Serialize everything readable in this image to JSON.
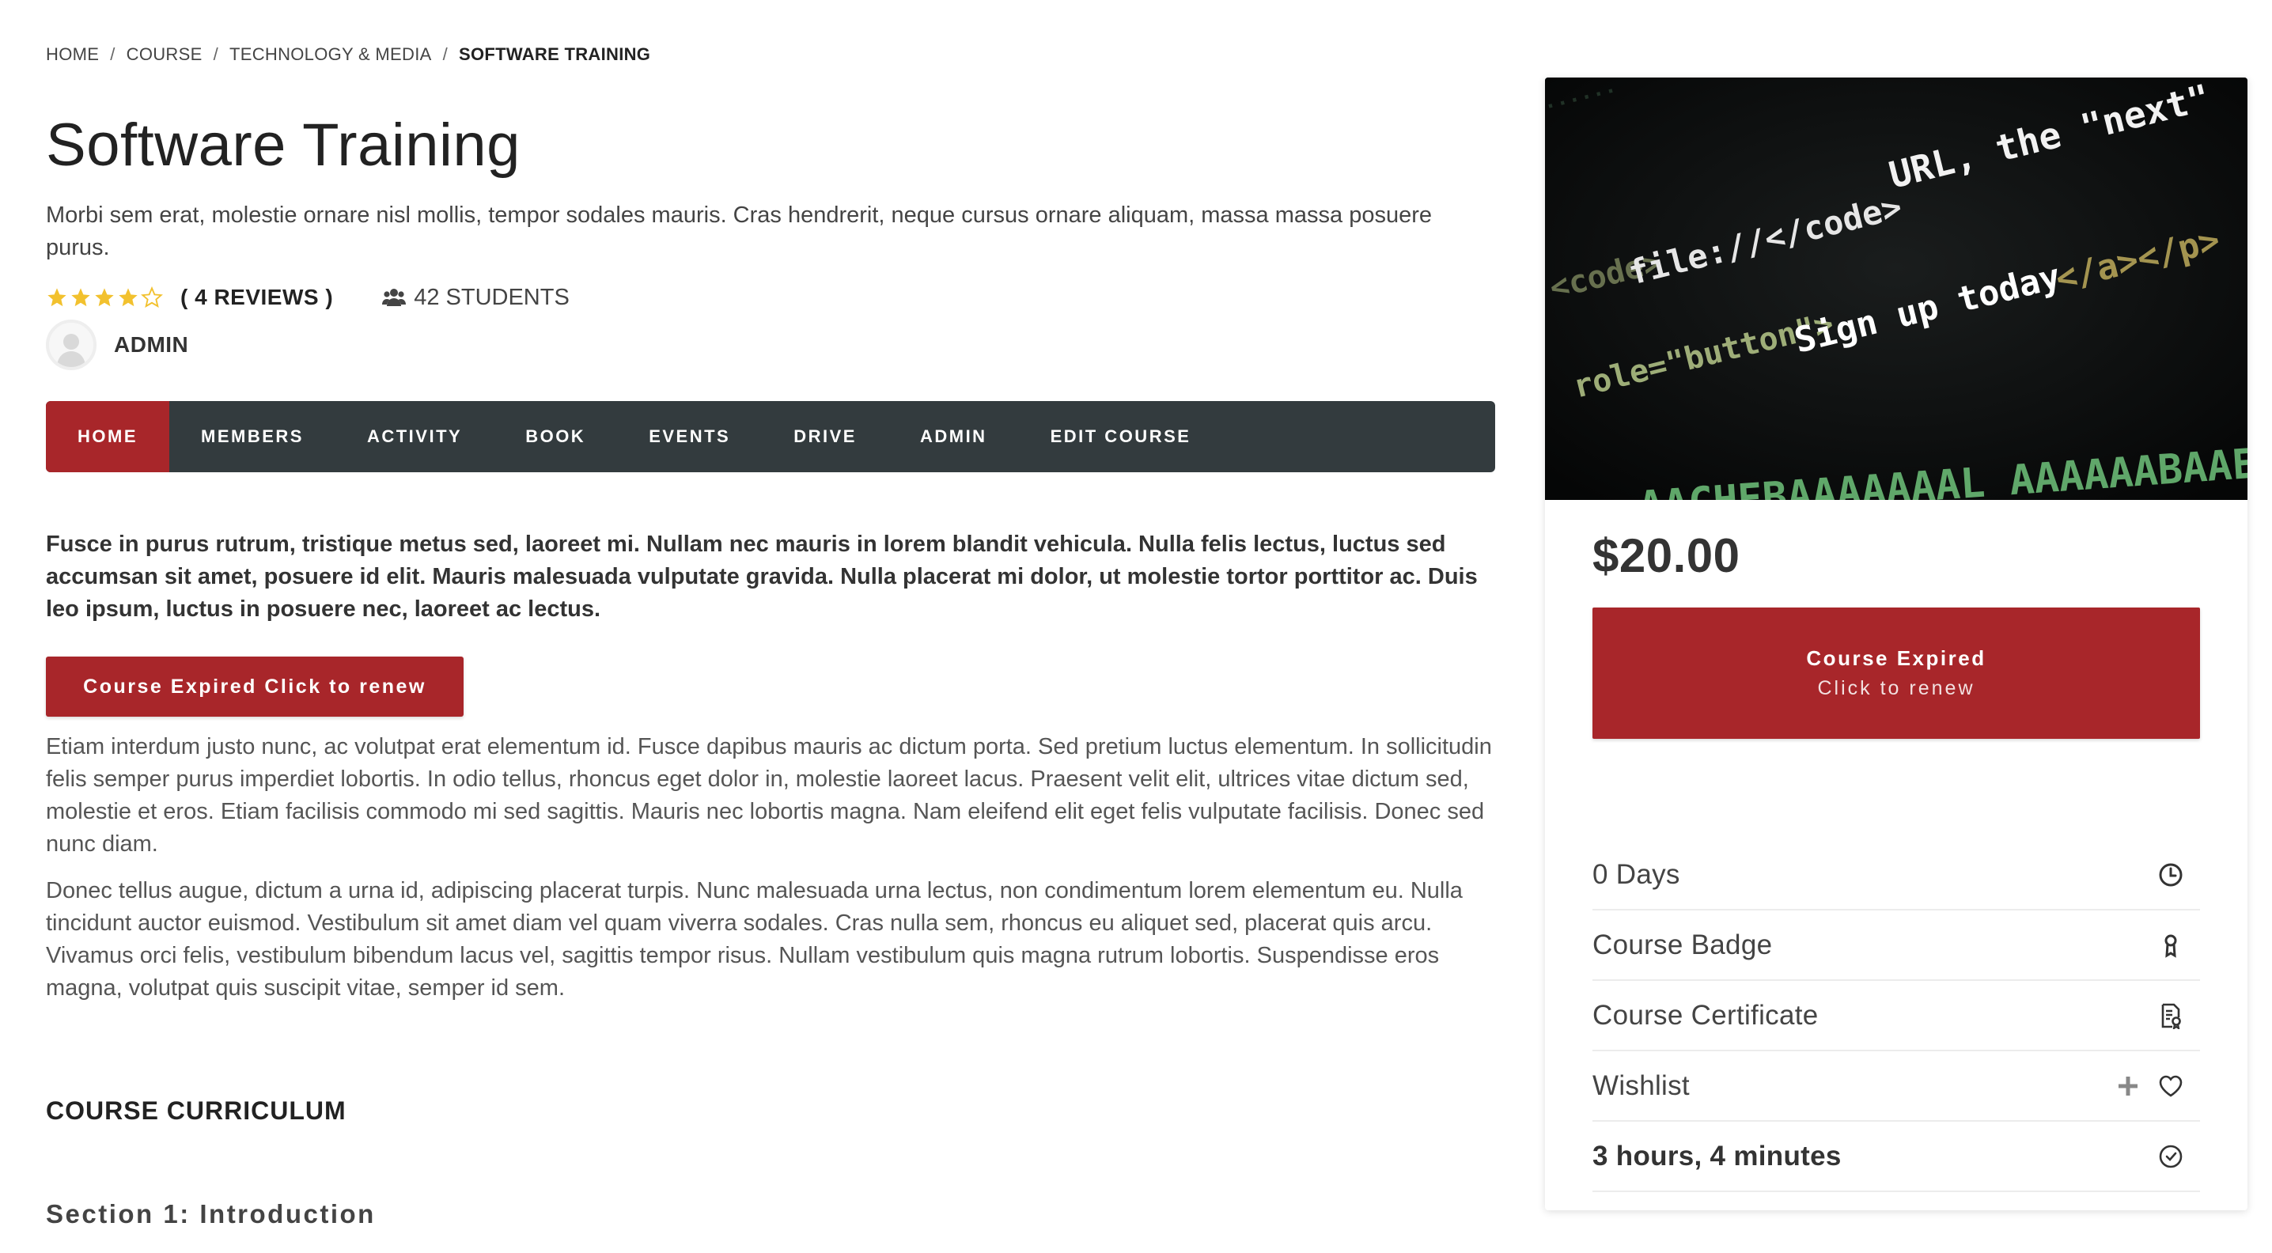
{
  "breadcrumb": {
    "home": "HOME",
    "course": "COURSE",
    "category": "TECHNOLOGY & MEDIA",
    "current": "SOFTWARE TRAINING",
    "separator": "/"
  },
  "course": {
    "title": "Software Training",
    "subtitle": "Morbi sem erat, molestie ornare nisl mollis, tempor sodales mauris. Cras hendrerit, neque cursus ornare aliquam, massa massa posuere purus.",
    "rating": 4,
    "rating_max": 5,
    "reviews_label": "( 4 REVIEWS )",
    "students_label": "42 STUDENTS",
    "instructor": "ADMIN"
  },
  "nav": {
    "tabs": [
      "HOME",
      "MEMBERS",
      "ACTIVITY",
      "BOOK",
      "EVENTS",
      "DRIVE",
      "ADMIN",
      "EDIT COURSE"
    ],
    "active": "HOME"
  },
  "content": {
    "lead": "Fusce in purus rutrum, tristique metus sed, laoreet mi. Nullam nec mauris in lorem blandit vehicula. Nulla felis lectus, luctus sed accumsan sit amet, posuere id elit. Mauris malesuada vulputate gravida. Nulla placerat mi dolor, ut molestie tortor porttitor ac. Duis leo ipsum, luctus in posuere nec, laoreet ac lectus.",
    "renew_button": "Course Expired Click to renew",
    "paragraph1": "Etiam interdum justo nunc, ac volutpat erat elementum id. Fusce dapibus mauris ac dictum porta. Sed pretium luctus elementum. In sollicitudin felis semper purus imperdiet lobortis. In odio tellus, rhoncus eget dolor in, molestie laoreet lacus. Praesent velit elit, ultrices vitae dictum sed, molestie et eros. Etiam facilisis commodo mi sed sagittis. Mauris nec lobortis magna. Nam eleifend elit eget felis vulputate facilisis. Donec sed nunc diam.",
    "paragraph2": "Donec tellus augue, dictum a urna id, adipiscing placerat turpis. Nunc malesuada urna lectus, non condimentum lorem elementum eu. Nulla tincidunt auctor euismod. Vestibulum sit amet diam vel quam viverra sodales. Cras nulla sem, rhoncus eu aliquet sed, placerat quis arcu. Vivamus orci felis, vestibulum bibendum lacus vel, sagittis tempor risus. Nullam vestibulum quis magna rutrum lobortis. Suspendisse eros magna, volutpat quis suscipit vitae, semper id sem.",
    "curriculum_heading": "COURSE CURRICULUM",
    "section_heading": "Section 1: Introduction"
  },
  "sidebar": {
    "hero_code": {
      "line1": "URL, the \"next\"",
      "line2_tag1": "<code>",
      "line2_text": "file://</code>",
      "line3_attr": "role=\"button\">",
      "line3_text": "Sign up today",
      "line3_end": "</a></p>",
      "line4": "AACHEBAAAAAAAL AAAAAABAAEAAAICP"
    },
    "price": "$20.00",
    "button_line1": "Course Expired",
    "button_line2": "Click to renew",
    "features": [
      {
        "label": "0 Days",
        "icon": "clock-icon"
      },
      {
        "label": "Course Badge",
        "icon": "badge-icon"
      },
      {
        "label": "Course Certificate",
        "icon": "certificate-icon"
      },
      {
        "label": "Wishlist",
        "icon": "heart-icon"
      },
      {
        "label": "3 hours, 4 minutes",
        "icon": "timer-icon"
      }
    ]
  },
  "colors": {
    "accent": "#a8262a",
    "nav_bg": "#333b3e",
    "star": "#f2c12e"
  }
}
